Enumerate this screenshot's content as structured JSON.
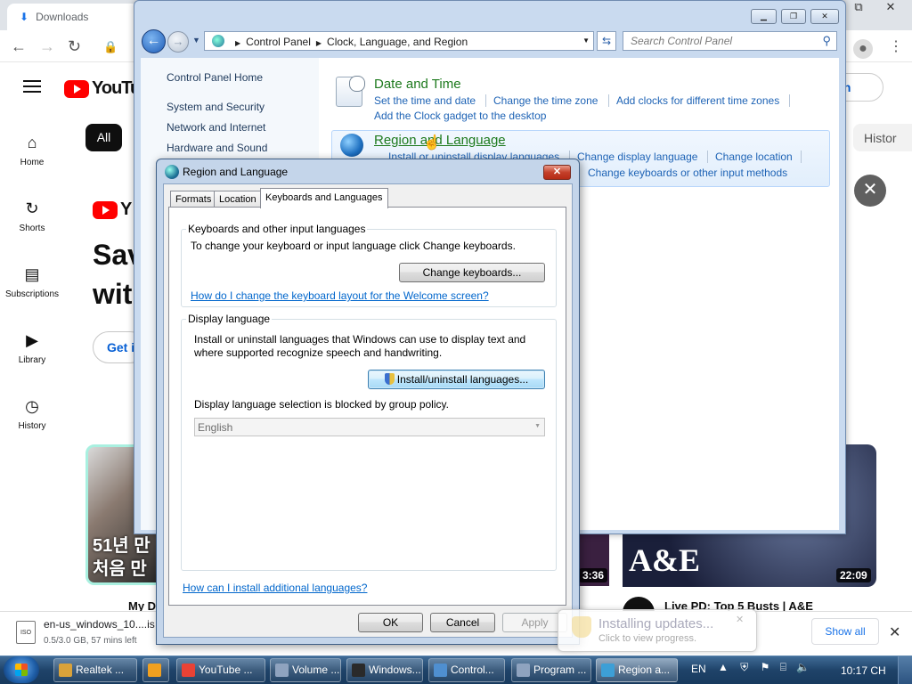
{
  "browser": {
    "tab_title": "Downloads",
    "win_ctrls": [
      "⧉",
      "✕"
    ]
  },
  "youtube": {
    "logo": "YouTube",
    "chip_all": "All",
    "chip_history": "Histor",
    "sign_in": "in",
    "sidebar": [
      {
        "icon": "home-icon",
        "glyph": "⌂",
        "label": "Home"
      },
      {
        "icon": "shorts-icon",
        "glyph": "↻",
        "label": "Shorts"
      },
      {
        "icon": "subscriptions-icon",
        "glyph": "▤",
        "label": "Subscriptions"
      },
      {
        "icon": "library-icon",
        "glyph": "▶",
        "label": "Library"
      },
      {
        "icon": "history-icon",
        "glyph": "◷",
        "label": "History"
      }
    ],
    "promo_line1": "Sav",
    "promo_line2": "wit",
    "promo_button": "Get i",
    "thumb1_text": "51년 만\n처음 만",
    "thumb2_duration": "3:36",
    "thumb3_logo": "A&E",
    "thumb3_duration": "22:09",
    "video_title": "Live PD: Top 5 Busts | A&E",
    "video_title_left": "My D"
  },
  "download_bar": {
    "file_icon_text": "ISO",
    "file_name": "en-us_windows_10....is",
    "status": "0.5/3.0 GB, 57 mins left",
    "show_all": "Show all"
  },
  "balloon": {
    "title": "Installing updates...",
    "subtitle": "Click to view progress."
  },
  "control_panel": {
    "address": {
      "crumbs": [
        "Control Panel",
        "Clock, Language, and Region"
      ]
    },
    "search_placeholder": "Search Control Panel",
    "left_nav": [
      "Control Panel Home",
      "System and Security",
      "Network and Internet",
      "Hardware and Sound"
    ],
    "categories": {
      "date_time": {
        "title": "Date and Time",
        "links": [
          "Set the time and date",
          "Change the time zone",
          "Add clocks for different time zones",
          "Add the Clock gadget to the desktop"
        ]
      },
      "region_language": {
        "title": "Region and Language",
        "links": [
          "Install or uninstall display languages",
          "Change display language",
          "Change location",
          "Change keyboards or other input methods"
        ]
      }
    }
  },
  "dialog": {
    "title": "Region and Language",
    "tabs": [
      "Formats",
      "Location",
      "Keyboards and Languages"
    ],
    "keyboards_group": {
      "caption": "Keyboards and other input languages",
      "description": "To change your keyboard or input language click Change keyboards.",
      "button": "Change keyboards...",
      "help_link": "How do I change the keyboard layout for the Welcome screen?"
    },
    "display_group": {
      "caption": "Display language",
      "description_line1": "Install or uninstall languages that Windows can use to display text and",
      "description_line2": "where supported recognize speech and handwriting.",
      "install_button": "Install/uninstall languages...",
      "blocked_text": "Display language selection is blocked by group policy.",
      "selected_language": "English"
    },
    "additional_link": "How can I install additional languages?",
    "ok": "OK",
    "cancel": "Cancel",
    "apply": "Apply"
  },
  "taskbar": {
    "items": [
      {
        "label": "Realtek ...",
        "color": "#d9a23a"
      },
      {
        "label": "",
        "color": "#f0a020"
      },
      {
        "label": "YouTube ...",
        "color": "#e94235"
      },
      {
        "label": "Volume ...",
        "color": "#8fa3bf"
      },
      {
        "label": "Windows...",
        "color": "#2a2a2a"
      },
      {
        "label": "Control...",
        "color": "#4f8fd0"
      },
      {
        "label": "Program ...",
        "color": "#8fa3bf"
      },
      {
        "label": "Region a...",
        "color": "#3d9fd6"
      }
    ],
    "language": "EN",
    "clock": "10:17 CH"
  }
}
